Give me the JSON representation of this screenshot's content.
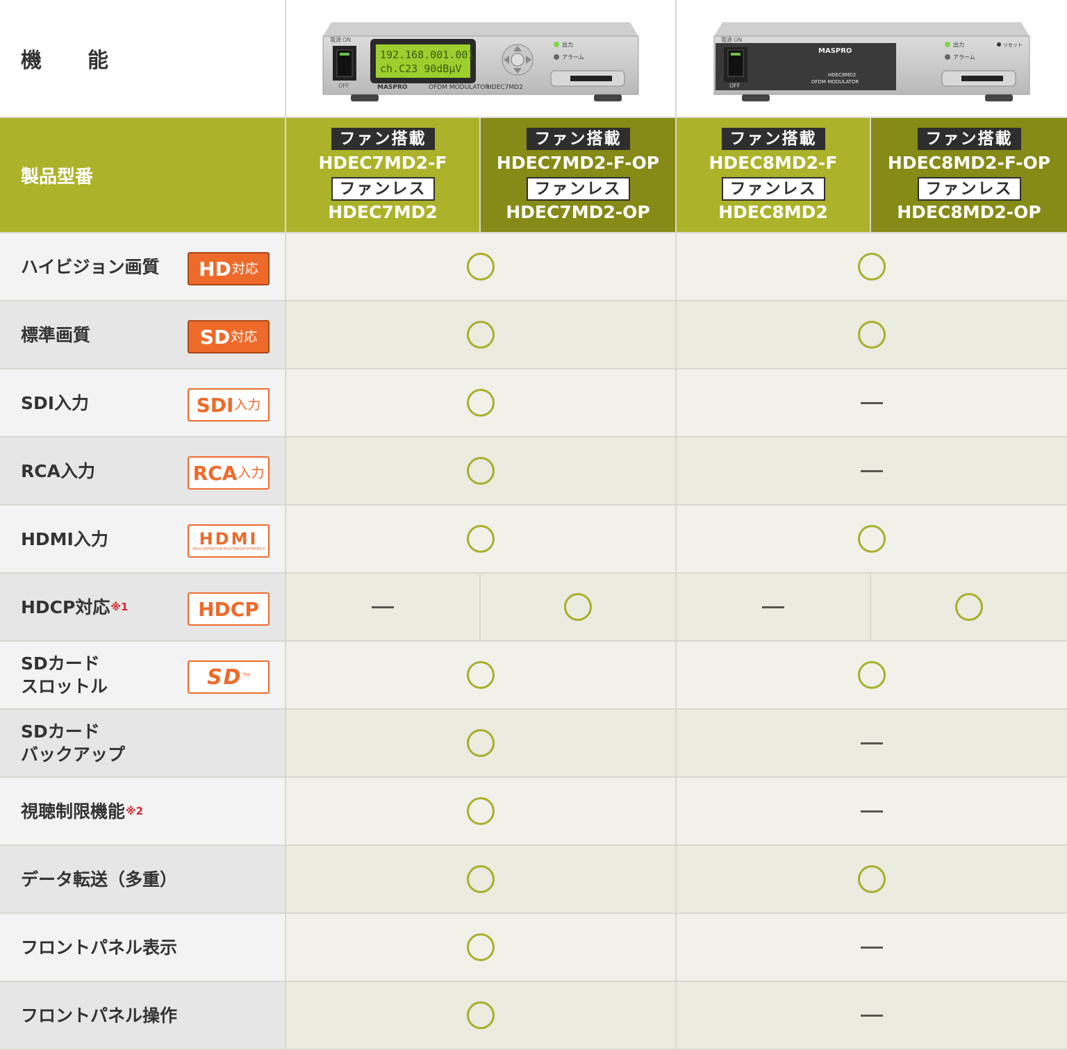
{
  "header": {
    "function_label": "機　能",
    "model_label": "製品型番"
  },
  "devices": [
    {
      "display_line1": "192.168.001.001",
      "display_line2": "ch.C23  90dBμV",
      "brand": "MASPRO",
      "caption": "OFDM MODULATOR",
      "model": "HDEC7MD2",
      "switch_on": "ON",
      "switch_off": "OFF",
      "switch_label": "電源",
      "led1": "出力",
      "led2": "アラーム"
    },
    {
      "brand": "MASPRO",
      "model": "HDEC8MD2",
      "caption": "OFDM MODULATOR",
      "switch_on": "ON",
      "switch_off": "OFF",
      "switch_label": "電源",
      "led1": "出力",
      "led2": "アラーム",
      "reset": "リセット"
    }
  ],
  "models": [
    {
      "fan_tag": "ファン搭載",
      "fan_model": "HDEC7MD2-F",
      "fanless_tag": "ファンレス",
      "fanless_model": "HDEC7MD2"
    },
    {
      "fan_tag": "ファン搭載",
      "fan_model": "HDEC7MD2-F-OP",
      "fanless_tag": "ファンレス",
      "fanless_model": "HDEC7MD2-OP"
    },
    {
      "fan_tag": "ファン搭載",
      "fan_model": "HDEC8MD2-F",
      "fanless_tag": "ファンレス",
      "fanless_model": "HDEC8MD2"
    },
    {
      "fan_tag": "ファン搭載",
      "fan_model": "HDEC8MD2-F-OP",
      "fanless_tag": "ファンレス",
      "fanless_model": "HDEC8MD2-OP"
    }
  ],
  "features": [
    {
      "label": "ハイビジョン画質",
      "badge": {
        "main": "HD",
        "sub": "対応",
        "style": "fill"
      },
      "hdec7": "circle",
      "hdec8": "circle"
    },
    {
      "label": "標準画質",
      "badge": {
        "main": "SD",
        "sub": "対応",
        "style": "fill"
      },
      "hdec7": "circle",
      "hdec8": "circle"
    },
    {
      "label": "SDI入力",
      "badge": {
        "main": "SDI",
        "sub": "入力",
        "style": "outline"
      },
      "hdec7": "circle",
      "hdec8": "dash"
    },
    {
      "label": "RCA入力",
      "badge": {
        "main": "RCA",
        "sub": "入力",
        "style": "outline"
      },
      "hdec7": "circle",
      "hdec8": "dash"
    },
    {
      "label": "HDMI入力",
      "badge": {
        "main": "HDMI",
        "sub": "HIGH-DEFINITION MULTIMEDIA INTERFACE",
        "style": "outline"
      },
      "hdec7": "circle",
      "hdec8": "circle"
    },
    {
      "label": "HDCP対応",
      "note": "※1",
      "badge": {
        "main": "HDCP",
        "sub": "",
        "style": "outline"
      },
      "split": true,
      "values": [
        "dash",
        "circle",
        "dash",
        "circle"
      ]
    },
    {
      "label_line1": "SDカード",
      "label_line2": "スロットル",
      "badge": {
        "main": "SD",
        "sub": "TM",
        "style": "outline"
      },
      "hdec7": "circle",
      "hdec8": "circle"
    },
    {
      "label_line1": "SDカード",
      "label_line2": "バックアップ",
      "hdec7": "circle",
      "hdec8": "dash"
    },
    {
      "label": "視聴制限機能",
      "note": "※2",
      "hdec7": "circle",
      "hdec8": "dash"
    },
    {
      "label": "データ転送（多重）",
      "hdec7": "circle",
      "hdec8": "circle"
    },
    {
      "label": "フロントパネル表示",
      "hdec7": "circle",
      "hdec8": "dash"
    },
    {
      "label": "フロントパネル操作",
      "hdec7": "circle",
      "hdec8": "dash"
    }
  ],
  "colors": {
    "accent_light": "#acb22a",
    "accent_dark": "#868a16",
    "badge_orange": "#ee6a2b",
    "circle": "#a9ae2b",
    "note_red": "#d8262e"
  }
}
